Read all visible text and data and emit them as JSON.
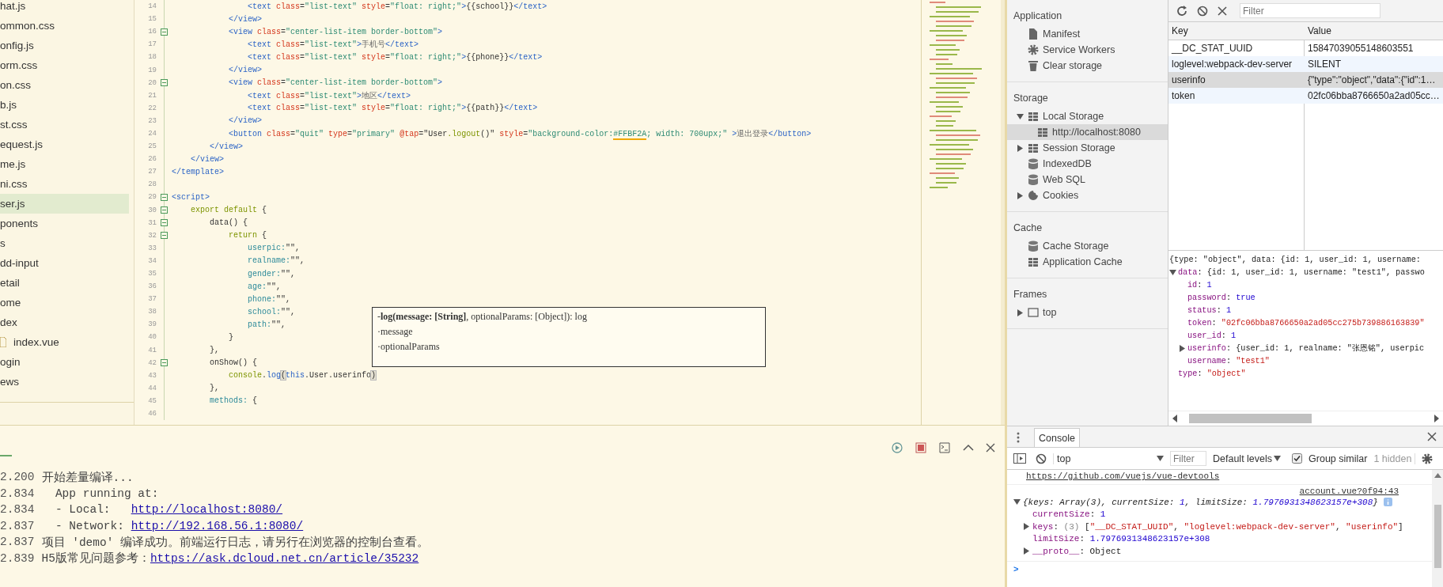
{
  "file_tree": {
    "items": [
      {
        "label": "hat.js",
        "selected": false
      },
      {
        "label": "ommon.css",
        "selected": false
      },
      {
        "label": "onfig.js",
        "selected": false
      },
      {
        "label": "orm.css",
        "selected": false
      },
      {
        "label": "on.css",
        "selected": false
      },
      {
        "label": "b.js",
        "selected": false
      },
      {
        "label": "st.css",
        "selected": false
      },
      {
        "label": "equest.js",
        "selected": false
      },
      {
        "label": "me.js",
        "selected": false
      },
      {
        "label": "ni.css",
        "selected": false
      },
      {
        "label": "ser.js",
        "selected": true
      },
      {
        "label": "ponents",
        "selected": false
      },
      {
        "label": "s",
        "selected": false
      },
      {
        "label": "dd-input",
        "selected": false
      },
      {
        "label": "etail",
        "selected": false
      },
      {
        "label": "ome",
        "selected": false
      },
      {
        "label": "dex",
        "selected": false,
        "children": [
          {
            "label": "index.vue",
            "selected": false
          }
        ]
      },
      {
        "label": "ogin",
        "selected": false
      },
      {
        "label": "ews",
        "selected": false
      }
    ]
  },
  "editor": {
    "lines": [
      {
        "number": "14",
        "fold": false,
        "tokens": [
          {
            "text": "                <text",
            "kind": "tag"
          },
          {
            "text": " class",
            "kind": "attr"
          },
          {
            "text": "=",
            "kind": "punct"
          },
          {
            "text": "\"list-text\"",
            "kind": "str"
          },
          {
            "text": " style",
            "kind": "attr"
          },
          {
            "text": "=",
            "kind": "punct"
          },
          {
            "text": "\"float: right;\"",
            "kind": "str"
          },
          {
            "text": ">",
            "kind": "tag"
          },
          {
            "text": "{{school}}",
            "kind": "punct"
          },
          {
            "text": "</text>",
            "kind": "tag"
          }
        ]
      },
      {
        "number": "15",
        "fold": false,
        "tokens": [
          {
            "text": "            </view>",
            "kind": "tag"
          }
        ]
      },
      {
        "number": "16",
        "fold": true,
        "tokens": [
          {
            "text": "            <view",
            "kind": "tag"
          },
          {
            "text": " class",
            "kind": "attr"
          },
          {
            "text": "=",
            "kind": "punct"
          },
          {
            "text": "\"center-list-item border-bottom\"",
            "kind": "str"
          },
          {
            "text": ">",
            "kind": "tag"
          }
        ]
      },
      {
        "number": "17",
        "fold": false,
        "tokens": [
          {
            "text": "                <text",
            "kind": "tag"
          },
          {
            "text": " class",
            "kind": "attr"
          },
          {
            "text": "=",
            "kind": "punct"
          },
          {
            "text": "\"list-text\"",
            "kind": "str"
          },
          {
            "text": ">",
            "kind": "tag"
          },
          {
            "text": "手机号",
            "kind": "text"
          },
          {
            "text": "</text>",
            "kind": "tag"
          }
        ]
      },
      {
        "number": "18",
        "fold": false,
        "tokens": [
          {
            "text": "                <text",
            "kind": "tag"
          },
          {
            "text": " class",
            "kind": "attr"
          },
          {
            "text": "=",
            "kind": "punct"
          },
          {
            "text": "\"list-text\"",
            "kind": "str"
          },
          {
            "text": " style",
            "kind": "attr"
          },
          {
            "text": "=",
            "kind": "punct"
          },
          {
            "text": "\"float: right;\"",
            "kind": "str"
          },
          {
            "text": ">",
            "kind": "tag"
          },
          {
            "text": "{{phone}}",
            "kind": "punct"
          },
          {
            "text": "</text>",
            "kind": "tag"
          }
        ]
      },
      {
        "number": "19",
        "fold": false,
        "tokens": [
          {
            "text": "            </view>",
            "kind": "tag"
          }
        ]
      },
      {
        "number": "20",
        "fold": true,
        "tokens": [
          {
            "text": "            <view",
            "kind": "tag"
          },
          {
            "text": " class",
            "kind": "attr"
          },
          {
            "text": "=",
            "kind": "punct"
          },
          {
            "text": "\"center-list-item border-bottom\"",
            "kind": "str"
          },
          {
            "text": ">",
            "kind": "tag"
          }
        ]
      },
      {
        "number": "21",
        "fold": false,
        "tokens": [
          {
            "text": "                <text",
            "kind": "tag"
          },
          {
            "text": " class",
            "kind": "attr"
          },
          {
            "text": "=",
            "kind": "punct"
          },
          {
            "text": "\"list-text\"",
            "kind": "str"
          },
          {
            "text": ">",
            "kind": "tag"
          },
          {
            "text": "地区",
            "kind": "text"
          },
          {
            "text": "</text>",
            "kind": "tag"
          }
        ]
      },
      {
        "number": "22",
        "fold": false,
        "tokens": [
          {
            "text": "                <text",
            "kind": "tag"
          },
          {
            "text": " class",
            "kind": "attr"
          },
          {
            "text": "=",
            "kind": "punct"
          },
          {
            "text": "\"list-text\"",
            "kind": "str"
          },
          {
            "text": " style",
            "kind": "attr"
          },
          {
            "text": "=",
            "kind": "punct"
          },
          {
            "text": "\"float: right;\"",
            "kind": "str"
          },
          {
            "text": ">",
            "kind": "tag"
          },
          {
            "text": "{{path}}",
            "kind": "punct"
          },
          {
            "text": "</text>",
            "kind": "tag"
          }
        ]
      },
      {
        "number": "23",
        "fold": false,
        "tokens": [
          {
            "text": "            </view>",
            "kind": "tag"
          }
        ]
      },
      {
        "number": "24",
        "fold": false,
        "tokens": [
          {
            "text": "            <button",
            "kind": "tag"
          },
          {
            "text": " class",
            "kind": "attr"
          },
          {
            "text": "=",
            "kind": "punct"
          },
          {
            "text": "\"quit\"",
            "kind": "str"
          },
          {
            "text": " type",
            "kind": "attr"
          },
          {
            "text": "=",
            "kind": "punct"
          },
          {
            "text": "\"primary\"",
            "kind": "str"
          },
          {
            "text": " @tap",
            "kind": "attr"
          },
          {
            "text": "=",
            "kind": "punct"
          },
          {
            "text": "\"User",
            "kind": "punct"
          },
          {
            "text": ".logout",
            "kind": "kw"
          },
          {
            "text": "()\"",
            "kind": "punct"
          },
          {
            "text": " style",
            "kind": "attr"
          },
          {
            "text": "=",
            "kind": "punct"
          },
          {
            "text": "\"background-color:",
            "kind": "str"
          },
          {
            "text": "#FFBF2A",
            "kind": "color"
          },
          {
            "text": "; width: 700upx;\"",
            "kind": "str"
          },
          {
            "text": " >",
            "kind": "tag"
          },
          {
            "text": "退出登录",
            "kind": "text"
          },
          {
            "text": "</button>",
            "kind": "tag"
          }
        ]
      },
      {
        "number": "25",
        "fold": false,
        "tokens": [
          {
            "text": "        </view>",
            "kind": "tag"
          }
        ]
      },
      {
        "number": "26",
        "fold": false,
        "tokens": [
          {
            "text": "    </view>",
            "kind": "tag"
          }
        ]
      },
      {
        "number": "27",
        "fold": false,
        "tokens": [
          {
            "text": "</template>",
            "kind": "tag"
          }
        ]
      },
      {
        "number": "28",
        "fold": false
      },
      {
        "number": "29",
        "fold": true,
        "tokens": [
          {
            "text": "<script>",
            "kind": "tag"
          }
        ]
      },
      {
        "number": "30",
        "fold": true,
        "tokens": [
          {
            "text": "    export default",
            "kind": "kw"
          },
          {
            "text": " {",
            "kind": "punct"
          }
        ]
      },
      {
        "number": "31",
        "fold": true,
        "tokens": [
          {
            "text": "        data() {",
            "kind": "punct"
          }
        ]
      },
      {
        "number": "32",
        "fold": true,
        "tokens": [
          {
            "text": "            return",
            "kind": "kw"
          },
          {
            "text": " {",
            "kind": "punct"
          }
        ]
      },
      {
        "number": "33",
        "fold": false,
        "tokens": [
          {
            "text": "                userpic:",
            "kind": "prop"
          },
          {
            "text": "\"\",",
            "kind": "punct"
          }
        ]
      },
      {
        "number": "34",
        "fold": false,
        "tokens": [
          {
            "text": "                realname:",
            "kind": "prop"
          },
          {
            "text": "\"\",",
            "kind": "punct"
          }
        ]
      },
      {
        "number": "35",
        "fold": false,
        "tokens": [
          {
            "text": "                gender:",
            "kind": "prop"
          },
          {
            "text": "\"\",",
            "kind": "punct"
          }
        ]
      },
      {
        "number": "36",
        "fold": false,
        "tokens": [
          {
            "text": "                age:",
            "kind": "prop"
          },
          {
            "text": "\"\",",
            "kind": "punct"
          }
        ]
      },
      {
        "number": "37",
        "fold": false,
        "tokens": [
          {
            "text": "                phone:",
            "kind": "prop"
          },
          {
            "text": "\"\",",
            "kind": "punct"
          }
        ]
      },
      {
        "number": "38",
        "fold": false,
        "tokens": [
          {
            "text": "                school:",
            "kind": "prop"
          },
          {
            "text": "\"\",",
            "kind": "punct"
          }
        ]
      },
      {
        "number": "39",
        "fold": false,
        "tokens": [
          {
            "text": "                path:",
            "kind": "prop"
          },
          {
            "text": "\"\",",
            "kind": "punct"
          }
        ]
      },
      {
        "number": "40",
        "fold": false,
        "tokens": [
          {
            "text": "            }",
            "kind": "punct"
          }
        ]
      },
      {
        "number": "41",
        "fold": false,
        "tokens": [
          {
            "text": "        },",
            "kind": "punct"
          }
        ]
      },
      {
        "number": "42",
        "fold": true,
        "tokens": [
          {
            "text": "        onShow() {",
            "kind": "punct"
          }
        ]
      },
      {
        "number": "43",
        "fold": false,
        "tokens": [
          {
            "text": "            console",
            "kind": "kw"
          },
          {
            "text": ".",
            "kind": "punct"
          },
          {
            "text": "log",
            "kind": "tag"
          },
          {
            "text": "(",
            "kind": "bracket"
          },
          {
            "text": "this",
            "kind": "tag"
          },
          {
            "text": ".User.userinfo",
            "kind": "punct"
          },
          {
            "text": ")",
            "kind": "bracket"
          }
        ]
      },
      {
        "number": "44",
        "fold": false,
        "tokens": [
          {
            "text": "        },",
            "kind": "punct"
          }
        ]
      },
      {
        "number": "45",
        "fold": false,
        "tokens": [
          {
            "text": "        methods:",
            "kind": "prop"
          },
          {
            "text": " {",
            "kind": "punct"
          }
        ]
      },
      {
        "number": "46",
        "fold": false
      }
    ],
    "tooltip": {
      "signature": "-**log(message: [String]**, optionalParams: [Object]): log",
      "params": [
        "·message",
        "·optionalParams"
      ]
    }
  },
  "run_log": {
    "lines": [
      {
        "time": "2.200",
        "parts": [
          {
            "text": "开始差量编译...",
            "link": false
          }
        ]
      },
      {
        "time": "2.834",
        "parts": [
          {
            "text": "  App running at:",
            "link": false
          }
        ]
      },
      {
        "time": "2.834",
        "parts": [
          {
            "text": "  - Local:   ",
            "link": false
          },
          {
            "text": "http://localhost:8080/",
            "link": true
          }
        ]
      },
      {
        "time": "2.837",
        "parts": [
          {
            "text": "  - Network: ",
            "link": false
          },
          {
            "text": "http://192.168.56.1:8080/",
            "link": true
          }
        ]
      },
      {
        "time": "2.837",
        "parts": [
          {
            "text": "项目 'demo' 编译成功。前端运行日志，请另行在浏览器的控制台查看。",
            "link": false
          }
        ]
      },
      {
        "time": "2.839",
        "parts": [
          {
            "text": "H5版常见问题参考：",
            "link": false
          },
          {
            "text": "https://ask.dcloud.net.cn/article/35232",
            "link": true
          }
        ]
      }
    ]
  },
  "devtools": {
    "sidebar": {
      "sections": [
        {
          "title": "Application",
          "items": [
            {
              "label": "Manifest",
              "kind": "file",
              "selected": false
            },
            {
              "label": "Service Workers",
              "kind": "gear",
              "selected": false
            },
            {
              "label": "Clear storage",
              "kind": "trash",
              "selected": false
            }
          ]
        },
        {
          "title": "Storage",
          "items": [
            {
              "label": "Local Storage",
              "kind": "grid",
              "selected": false,
              "expanded": true,
              "children": [
                {
                  "label": "http://localhost:8080",
                  "kind": "grid",
                  "selected": true
                }
              ]
            },
            {
              "label": "Session Storage",
              "kind": "grid",
              "selected": false,
              "expanded": false
            },
            {
              "label": "IndexedDB",
              "kind": "database",
              "selected": false
            },
            {
              "label": "Web SQL",
              "kind": "database",
              "selected": false
            },
            {
              "label": "Cookies",
              "kind": "cookie",
              "selected": false,
              "expanded": false
            }
          ]
        },
        {
          "title": "Cache",
          "items": [
            {
              "label": "Cache Storage",
              "kind": "database",
              "selected": false
            },
            {
              "label": "Application Cache",
              "kind": "grid",
              "selected": false
            }
          ]
        },
        {
          "title": "Frames",
          "items": [
            {
              "label": "top",
              "kind": "frame",
              "selected": false,
              "expanded": false
            }
          ]
        }
      ]
    },
    "storage": {
      "filter": {
        "placeholder": "Filter"
      },
      "columns": [
        "Key",
        "Value"
      ],
      "rows": [
        {
          "key": "__DC_STAT_UUID",
          "value": "15847039055148603551",
          "selected": false
        },
        {
          "key": "loglevel:webpack-dev-server",
          "value": "SILENT",
          "selected": false
        },
        {
          "key": "userinfo",
          "value": "{\"type\":\"object\",\"data\":{\"id\":1…",
          "selected": true
        },
        {
          "key": "token",
          "value": "02fc06bba8766650a2ad05cc…",
          "selected": false
        }
      ]
    },
    "preview": {
      "summary": [
        {
          "text": "{type: \"object\", data: {id: 1, user_id: 1, username:",
          "kind": "plain"
        }
      ],
      "entries": [
        {
          "expanded": true,
          "parts": [
            {
              "text": "data",
              "kind": "key"
            },
            {
              "text": ": {id: 1, user_id: 1, username: \"test1\", passwo",
              "kind": "plain"
            }
          ],
          "children": [
            {
              "parts": [
                {
                  "text": "id",
                  "kind": "key"
                },
                {
                  "text": ": ",
                  "kind": "plain"
                },
                {
                  "text": "1",
                  "kind": "number"
                }
              ]
            },
            {
              "parts": [
                {
                  "text": "password",
                  "kind": "key"
                },
                {
                  "text": ": ",
                  "kind": "plain"
                },
                {
                  "text": "true",
                  "kind": "number"
                }
              ]
            },
            {
              "parts": [
                {
                  "text": "status",
                  "kind": "key"
                },
                {
                  "text": ": ",
                  "kind": "plain"
                },
                {
                  "text": "1",
                  "kind": "number"
                }
              ]
            },
            {
              "parts": [
                {
                  "text": "token",
                  "kind": "key"
                },
                {
                  "text": ": ",
                  "kind": "plain"
                },
                {
                  "text": "\"02fc06bba8766650a2ad05cc275b739886163839\"",
                  "kind": "string"
                }
              ]
            },
            {
              "parts": [
                {
                  "text": "user_id",
                  "kind": "key"
                },
                {
                  "text": ": ",
                  "kind": "plain"
                },
                {
                  "text": "1",
                  "kind": "number"
                }
              ]
            },
            {
              "expanded": false,
              "parts": [
                {
                  "text": "userinfo",
                  "kind": "key"
                },
                {
                  "text": ": {user_id: 1, realname: \"张恩铭\", userpic",
                  "kind": "plain"
                }
              ]
            },
            {
              "parts": [
                {
                  "text": "username",
                  "kind": "key"
                },
                {
                  "text": ": ",
                  "kind": "plain"
                },
                {
                  "text": "\"test1\"",
                  "kind": "string"
                }
              ]
            }
          ]
        },
        {
          "parts": [
            {
              "text": "type",
              "kind": "key"
            },
            {
              "text": ": ",
              "kind": "plain"
            },
            {
              "text": "\"object\"",
              "kind": "string"
            }
          ]
        }
      ]
    },
    "console": {
      "tabs": [
        {
          "label": "Console",
          "selected": true
        }
      ],
      "context": "top",
      "filter": {
        "placeholder": "Filter"
      },
      "levels": "Default levels",
      "group_similar": {
        "label": "Group similar",
        "checked": true
      },
      "hidden_count": "1 hidden",
      "messages": [
        {
          "kind": "link",
          "text": "https://github.com/vuejs/vue-devtools"
        },
        {
          "kind": "object",
          "source": "account.vue?0f94:43",
          "expanded": true,
          "summary": [
            {
              "text": "{keys: Array(3), currentSize: ",
              "kind": "plain"
            },
            {
              "text": "1",
              "kind": "number"
            },
            {
              "text": ", limitSize: ",
              "kind": "plain"
            },
            {
              "text": "1.7976931348623157e+308",
              "kind": "number"
            },
            {
              "text": "}",
              "kind": "plain"
            }
          ],
          "entries": [
            {
              "parts": [
                {
                  "text": "currentSize",
                  "kind": "key"
                },
                {
                  "text": ": ",
                  "kind": "plain"
                },
                {
                  "text": "1",
                  "kind": "number"
                }
              ]
            },
            {
              "expanded": false,
              "parts": [
                {
                  "text": "keys",
                  "kind": "key"
                },
                {
                  "text": ": ",
                  "kind": "plain"
                },
                {
                  "text": "(3) ",
                  "kind": "grey"
                },
                {
                  "text": "[",
                  "kind": "plain"
                },
                {
                  "text": "\"__DC_STAT_UUID\"",
                  "kind": "string"
                },
                {
                  "text": ", ",
                  "kind": "plain"
                },
                {
                  "text": "\"loglevel:webpack-dev-server\"",
                  "kind": "string"
                },
                {
                  "text": ", ",
                  "kind": "plain"
                },
                {
                  "text": "\"userinfo\"",
                  "kind": "string"
                },
                {
                  "text": "]",
                  "kind": "plain"
                }
              ]
            },
            {
              "parts": [
                {
                  "text": "limitSize",
                  "kind": "key"
                },
                {
                  "text": ": ",
                  "kind": "plain"
                },
                {
                  "text": "1.7976931348623157e+308",
                  "kind": "number"
                }
              ]
            },
            {
              "expanded": false,
              "parts": [
                {
                  "text": "__proto__",
                  "kind": "key"
                },
                {
                  "text": ": Object",
                  "kind": "plain"
                }
              ]
            }
          ]
        }
      ],
      "prompt": ">"
    }
  }
}
